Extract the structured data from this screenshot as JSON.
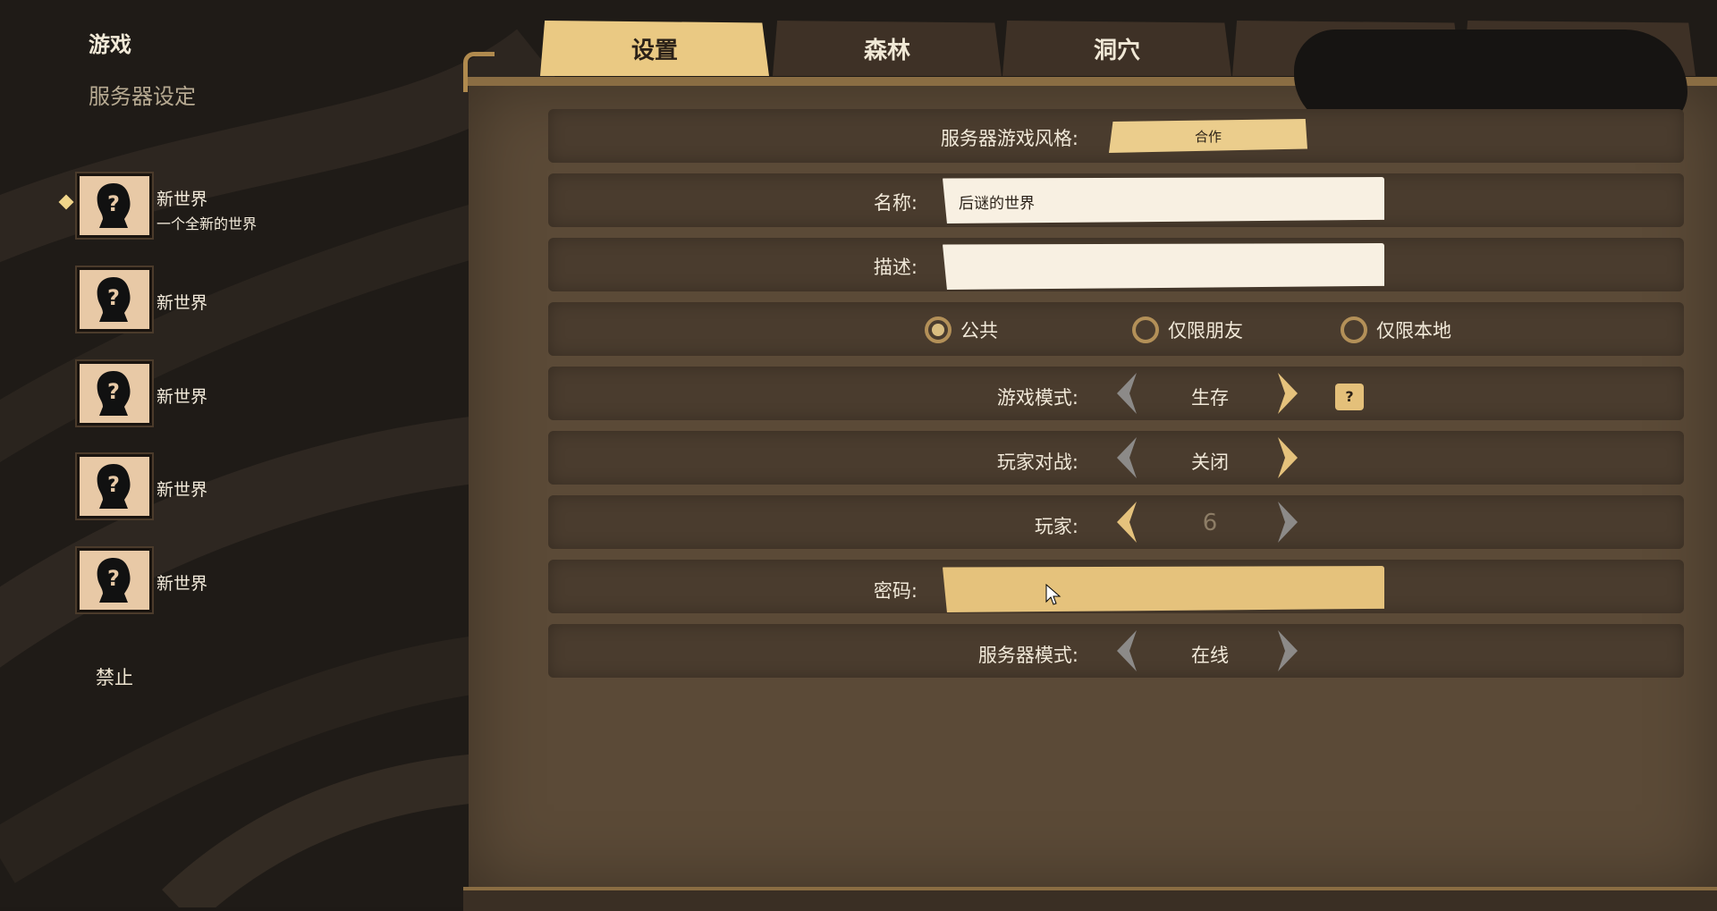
{
  "sidebar": {
    "title": "游戏",
    "subtitle": "服务器设定",
    "slots": [
      {
        "name": "新世界",
        "desc": "一个全新的世界"
      },
      {
        "name": "新世界",
        "desc": ""
      },
      {
        "name": "新世界",
        "desc": ""
      },
      {
        "name": "新世界",
        "desc": ""
      },
      {
        "name": "新世界",
        "desc": ""
      }
    ],
    "ban_label": "禁止"
  },
  "tabs": [
    {
      "label": "设置",
      "active": true
    },
    {
      "label": "森林",
      "active": false
    },
    {
      "label": "洞穴",
      "active": false
    }
  ],
  "settings": {
    "server_style_label": "服务器游戏风格:",
    "server_style_value": "合作",
    "name_label": "名称:",
    "name_value": "后谜的世界",
    "desc_label": "描述:",
    "desc_value": "",
    "privacy": [
      {
        "label": "公共",
        "selected": true
      },
      {
        "label": "仅限朋友",
        "selected": false
      },
      {
        "label": "仅限本地",
        "selected": false
      }
    ],
    "game_mode_label": "游戏模式:",
    "game_mode_value": "生存",
    "pvp_label": "玩家对战:",
    "pvp_value": "关闭",
    "players_label": "玩家:",
    "players_value": "6",
    "password_label": "密码:",
    "password_value": "",
    "server_mode_label": "服务器模式:",
    "server_mode_value": "在线",
    "help_glyph": "?"
  },
  "colors": {
    "accent_gold": "#eac983",
    "panel": "#5b4a37",
    "row": "#4a3c2e"
  }
}
